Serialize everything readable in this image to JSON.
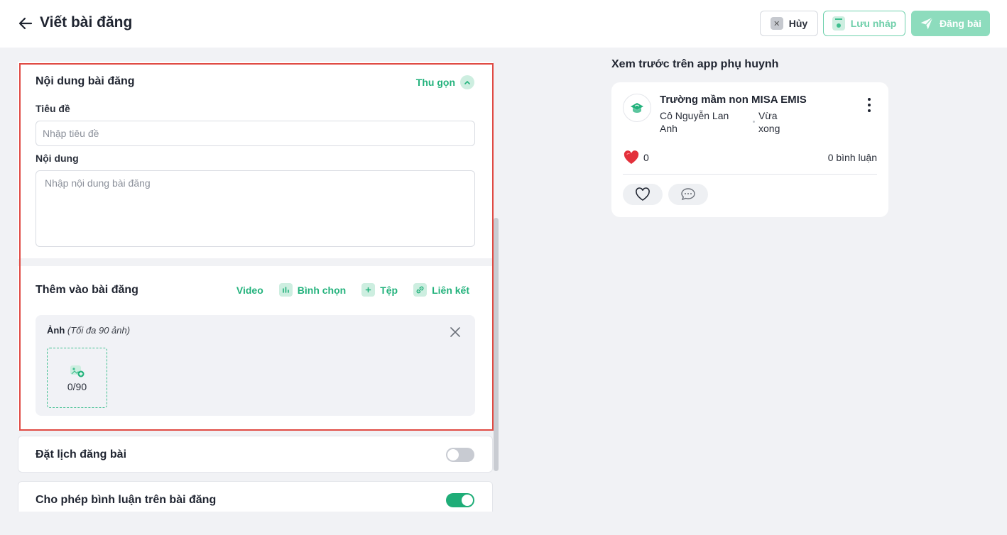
{
  "header": {
    "title": "Viết bài đăng",
    "cancel_label": "Hủy",
    "draft_label": "Lưu nháp",
    "post_label": "Đăng bài"
  },
  "content_section": {
    "title": "Nội dung bài đăng",
    "collapse_label": "Thu gọn",
    "title_label": "Tiêu đề",
    "title_placeholder": "Nhập tiêu đề",
    "title_value": "",
    "body_label": "Nội dung",
    "body_placeholder": "Nhập nội dung bài đăng",
    "body_value": ""
  },
  "add_section": {
    "title": "Thêm vào bài đăng",
    "actions": [
      {
        "label": "Video",
        "icon": "video-icon"
      },
      {
        "label": "Bình chọn",
        "icon": "poll-icon"
      },
      {
        "label": "Tệp",
        "icon": "file-add-icon"
      },
      {
        "label": "Liên kết",
        "icon": "link-icon"
      }
    ],
    "photos": {
      "label": "Ảnh",
      "limit_note": "(Tối đa 90 ảnh)",
      "count": "0/90"
    }
  },
  "schedule": {
    "label": "Đặt lịch đăng bài",
    "enabled": false
  },
  "allow_comments": {
    "label": "Cho phép bình luận trên bài đăng",
    "enabled": true
  },
  "preview": {
    "title": "Xem trước trên app phụ huynh",
    "school_name": "Trường mầm non MISA EMIS",
    "author": "Cô Nguyễn Lan Anh",
    "time": "Vừa xong",
    "like_count": "0",
    "comment_count": "0 bình luận"
  },
  "colors": {
    "accent": "#23b27c",
    "accent_light": "#cdeee0",
    "highlight_border": "#e04a43",
    "toggle_on": "#1fad78",
    "toggle_off": "#c8cbd2"
  }
}
